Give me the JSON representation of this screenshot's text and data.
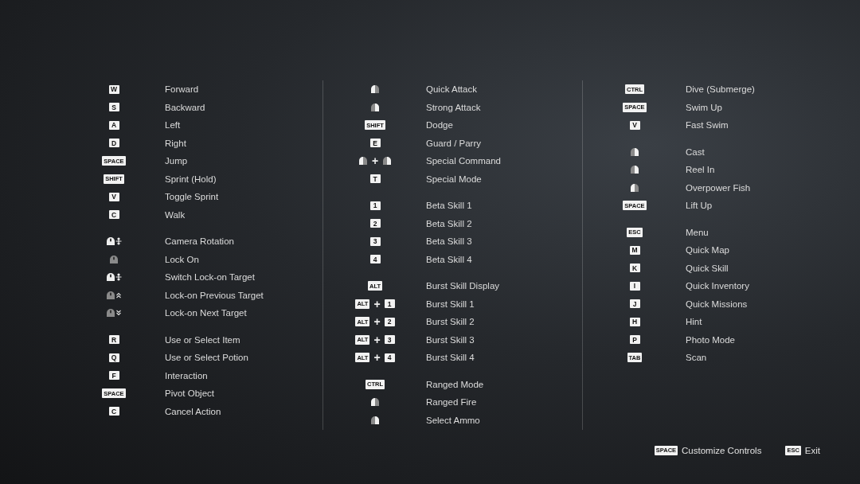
{
  "columns": [
    {
      "groups": [
        {
          "bindings": [
            {
              "keys": [
                {
                  "kind": "key",
                  "label": "W"
                }
              ],
              "action": "Forward"
            },
            {
              "keys": [
                {
                  "kind": "key",
                  "label": "S"
                }
              ],
              "action": "Backward"
            },
            {
              "keys": [
                {
                  "kind": "key",
                  "label": "A"
                }
              ],
              "action": "Left"
            },
            {
              "keys": [
                {
                  "kind": "key",
                  "label": "D"
                }
              ],
              "action": "Right"
            },
            {
              "keys": [
                {
                  "kind": "key",
                  "label": "SPACE"
                }
              ],
              "action": "Jump"
            },
            {
              "keys": [
                {
                  "kind": "key",
                  "label": "SHIFT"
                }
              ],
              "action": "Sprint (Hold)"
            },
            {
              "keys": [
                {
                  "kind": "key",
                  "label": "V"
                }
              ],
              "action": "Toggle Sprint"
            },
            {
              "keys": [
                {
                  "kind": "key",
                  "label": "C"
                }
              ],
              "action": "Walk"
            }
          ]
        },
        {
          "bindings": [
            {
              "keys": [
                {
                  "kind": "mousemove"
                }
              ],
              "action": "Camera Rotation"
            },
            {
              "keys": [
                {
                  "kind": "mousemiddle"
                }
              ],
              "action": "Lock On"
            },
            {
              "keys": [
                {
                  "kind": "mousemove"
                }
              ],
              "action": "Switch Lock-on Target"
            },
            {
              "keys": [
                {
                  "kind": "wheelup"
                }
              ],
              "action": "Lock-on Previous Target"
            },
            {
              "keys": [
                {
                  "kind": "wheeldown"
                }
              ],
              "action": "Lock-on Next Target"
            }
          ]
        },
        {
          "bindings": [
            {
              "keys": [
                {
                  "kind": "key",
                  "label": "R"
                }
              ],
              "action": "Use or Select Item"
            },
            {
              "keys": [
                {
                  "kind": "key",
                  "label": "Q"
                }
              ],
              "action": "Use or Select Potion"
            },
            {
              "keys": [
                {
                  "kind": "key",
                  "label": "F"
                }
              ],
              "action": "Interaction"
            },
            {
              "keys": [
                {
                  "kind": "key",
                  "label": "SPACE"
                }
              ],
              "action": "Pivot Object"
            },
            {
              "keys": [
                {
                  "kind": "key",
                  "label": "C"
                }
              ],
              "action": "Cancel Action"
            }
          ]
        }
      ]
    },
    {
      "groups": [
        {
          "bindings": [
            {
              "keys": [
                {
                  "kind": "mouseleft"
                }
              ],
              "action": "Quick Attack"
            },
            {
              "keys": [
                {
                  "kind": "mouseright"
                }
              ],
              "action": "Strong Attack"
            },
            {
              "keys": [
                {
                  "kind": "key",
                  "label": "SHIFT"
                }
              ],
              "action": "Dodge"
            },
            {
              "keys": [
                {
                  "kind": "key",
                  "label": "E"
                }
              ],
              "action": "Guard / Parry"
            },
            {
              "keys": [
                {
                  "kind": "mouseleft"
                },
                {
                  "kind": "plus",
                  "text": "+"
                },
                {
                  "kind": "mouseright"
                }
              ],
              "action": "Special Command"
            },
            {
              "keys": [
                {
                  "kind": "key",
                  "label": "T"
                }
              ],
              "action": "Special Mode"
            }
          ]
        },
        {
          "bindings": [
            {
              "keys": [
                {
                  "kind": "key",
                  "label": "1"
                }
              ],
              "action": "Beta Skill 1"
            },
            {
              "keys": [
                {
                  "kind": "key",
                  "label": "2"
                }
              ],
              "action": "Beta Skill 2"
            },
            {
              "keys": [
                {
                  "kind": "key",
                  "label": "3"
                }
              ],
              "action": "Beta Skill 3"
            },
            {
              "keys": [
                {
                  "kind": "key",
                  "label": "4"
                }
              ],
              "action": "Beta Skill 4"
            }
          ]
        },
        {
          "bindings": [
            {
              "keys": [
                {
                  "kind": "key",
                  "label": "ALT"
                }
              ],
              "action": "Burst Skill Display"
            },
            {
              "keys": [
                {
                  "kind": "key",
                  "label": "ALT"
                },
                {
                  "kind": "plus",
                  "text": "+"
                },
                {
                  "kind": "key",
                  "label": "1"
                }
              ],
              "action": "Burst Skill 1"
            },
            {
              "keys": [
                {
                  "kind": "key",
                  "label": "ALT"
                },
                {
                  "kind": "plus",
                  "text": "+"
                },
                {
                  "kind": "key",
                  "label": "2"
                }
              ],
              "action": "Burst Skill 2"
            },
            {
              "keys": [
                {
                  "kind": "key",
                  "label": "ALT"
                },
                {
                  "kind": "plus",
                  "text": "+"
                },
                {
                  "kind": "key",
                  "label": "3"
                }
              ],
              "action": "Burst Skill 3"
            },
            {
              "keys": [
                {
                  "kind": "key",
                  "label": "ALT"
                },
                {
                  "kind": "plus",
                  "text": "+"
                },
                {
                  "kind": "key",
                  "label": "4"
                }
              ],
              "action": "Burst Skill 4"
            }
          ]
        },
        {
          "bindings": [
            {
              "keys": [
                {
                  "kind": "key",
                  "label": "CTRL"
                }
              ],
              "action": "Ranged Mode"
            },
            {
              "keys": [
                {
                  "kind": "mouseleft"
                }
              ],
              "action": "Ranged Fire"
            },
            {
              "keys": [
                {
                  "kind": "mouseright"
                }
              ],
              "action": "Select Ammo"
            }
          ]
        }
      ]
    },
    {
      "groups": [
        {
          "bindings": [
            {
              "keys": [
                {
                  "kind": "key",
                  "label": "CTRL"
                }
              ],
              "action": "Dive (Submerge)"
            },
            {
              "keys": [
                {
                  "kind": "key",
                  "label": "SPACE"
                }
              ],
              "action": "Swim Up"
            },
            {
              "keys": [
                {
                  "kind": "key",
                  "label": "V"
                }
              ],
              "action": "Fast Swim"
            }
          ]
        },
        {
          "bindings": [
            {
              "keys": [
                {
                  "kind": "mouseright"
                }
              ],
              "action": "Cast"
            },
            {
              "keys": [
                {
                  "kind": "mouseright"
                }
              ],
              "action": "Reel In"
            },
            {
              "keys": [
                {
                  "kind": "mouseleft"
                }
              ],
              "action": "Overpower Fish"
            },
            {
              "keys": [
                {
                  "kind": "key",
                  "label": "SPACE"
                }
              ],
              "action": "Lift Up"
            }
          ]
        },
        {
          "bindings": [
            {
              "keys": [
                {
                  "kind": "key",
                  "label": "ESC"
                }
              ],
              "action": "Menu"
            },
            {
              "keys": [
                {
                  "kind": "key",
                  "label": "M"
                }
              ],
              "action": "Quick Map"
            },
            {
              "keys": [
                {
                  "kind": "key",
                  "label": "K"
                }
              ],
              "action": "Quick Skill"
            },
            {
              "keys": [
                {
                  "kind": "key",
                  "label": "I"
                }
              ],
              "action": "Quick Inventory"
            },
            {
              "keys": [
                {
                  "kind": "key",
                  "label": "J"
                }
              ],
              "action": "Quick Missions"
            },
            {
              "keys": [
                {
                  "kind": "key",
                  "label": "H"
                }
              ],
              "action": "Hint"
            },
            {
              "keys": [
                {
                  "kind": "key",
                  "label": "P"
                }
              ],
              "action": "Photo Mode"
            },
            {
              "keys": [
                {
                  "kind": "key",
                  "label": "TAB"
                }
              ],
              "action": "Scan"
            }
          ]
        }
      ]
    }
  ],
  "footer": [
    {
      "key": "SPACE",
      "label": "Customize Controls"
    },
    {
      "key": "ESC",
      "label": "Exit"
    }
  ]
}
